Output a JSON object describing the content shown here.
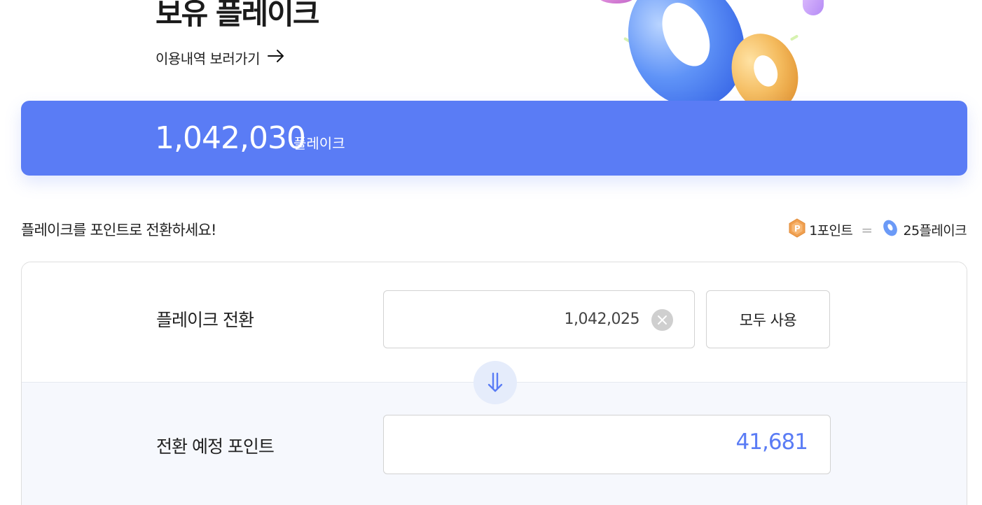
{
  "hero": {
    "title": "보유 플레이크",
    "history_link": "이용내역 보러가기"
  },
  "balance": {
    "amount": "1,042,030",
    "unit": "플레이크"
  },
  "convert": {
    "prompt": "플레이크를 포인트로 전환하세요!",
    "rate": {
      "point_label": "1포인트",
      "equals": "=",
      "flake_label": "25플레이크"
    }
  },
  "form": {
    "flake_label": "플레이크 전환",
    "flake_value": "1,042,025",
    "use_all_button": "모두 사용",
    "result_label": "전환 예정 포인트",
    "result_value": "41,681"
  },
  "icons": {
    "history_arrow": "arrow-right-icon",
    "coin": "point-coin-icon",
    "flake": "flake-donut-icon",
    "clear": "close-icon",
    "convert_arrow": "double-arrow-down-icon"
  },
  "colors": {
    "accent": "#5a7cf5",
    "result_text": "#5a7cf5",
    "panel_bg": "#f6f8fd",
    "coin": "#f0a050"
  }
}
